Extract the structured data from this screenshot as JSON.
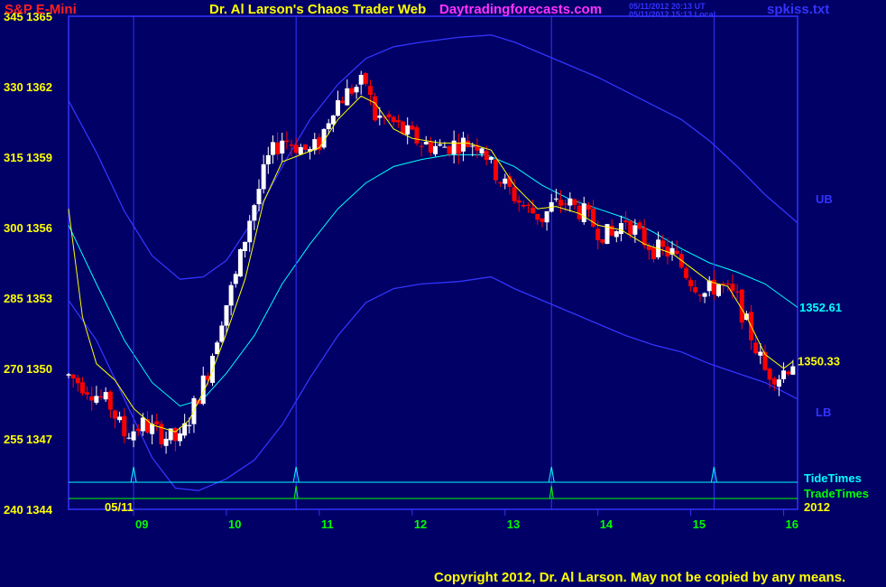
{
  "header": {
    "instrument": "S&P E-Mini",
    "title": "Dr. Al Larson's Chaos Trader Web",
    "site": "Daytradingforecasts.com",
    "timestamp_1": "05/11/2012 20:13 UT",
    "timestamp_2": "05/11/2012 15:13 Local",
    "file": "spkiss.txt"
  },
  "footer": {
    "copyright": "Copyright 2012, Dr. Al Larson. May not be copied by any means."
  },
  "colors": {
    "background": "#000066",
    "frame": "#3333ff",
    "up_candle": "#ffffff",
    "down_candle": "#ff0000",
    "ma_fast": "#ffff00",
    "ma_mid": "#00ffff",
    "bands": "#3333ff",
    "tide_times": "#00ffff",
    "trade_times": "#00ff00",
    "date_labels": "#00ff00",
    "price_labels": "#ffff00"
  },
  "chart_data": {
    "type": "candlestick",
    "y_left_labels": [
      "345",
      "330",
      "315",
      "300",
      "285",
      "270",
      "255",
      "240"
    ],
    "y_right_prices": [
      "1365",
      "1362",
      "1359",
      "1356",
      "1353",
      "1350",
      "1347",
      "1344"
    ],
    "ylim": [
      1344,
      1365
    ],
    "x_date_label": "05/11",
    "x_tick_labels": [
      "09",
      "10",
      "11",
      "12",
      "13",
      "14",
      "15",
      "16"
    ],
    "x_tick_hours": [
      9,
      10,
      11,
      12,
      13,
      14,
      15,
      16
    ],
    "x_range_hours": [
      8.3,
      16.15
    ],
    "year_label": "2012",
    "band_labels": {
      "upper": "UB",
      "lower": "LB"
    },
    "price_tags": [
      {
        "label": "1352.61",
        "value": 1352.61,
        "color": "#00ffff"
      },
      {
        "label": "1350.33",
        "value": 1350.33,
        "color": "#ffff00"
      }
    ],
    "event_lines": {
      "tide_times_label": "TideTimes",
      "trade_times_label": "TradeTimes",
      "tide_times_hours": [
        9.0,
        10.75,
        13.5,
        15.25
      ],
      "trade_times_hours": [
        10.75,
        13.5
      ]
    },
    "price_path": [
      [
        8.3,
        1349.7
      ],
      [
        8.5,
        1349.2
      ],
      [
        8.75,
        1348.4
      ],
      [
        8.9,
        1347.2
      ],
      [
        9.1,
        1347.6
      ],
      [
        9.35,
        1347.1
      ],
      [
        9.5,
        1346.9
      ],
      [
        9.65,
        1348.4
      ],
      [
        9.8,
        1349.9
      ],
      [
        9.95,
        1352.2
      ],
      [
        10.1,
        1353.9
      ],
      [
        10.25,
        1356.4
      ],
      [
        10.45,
        1358.9
      ],
      [
        10.6,
        1359.8
      ],
      [
        10.75,
        1359.5
      ],
      [
        10.9,
        1359.2
      ],
      [
        11.0,
        1359.6
      ],
      [
        11.15,
        1361.2
      ],
      [
        11.35,
        1361.9
      ],
      [
        11.5,
        1362.2
      ],
      [
        11.6,
        1360.7
      ],
      [
        11.75,
        1360.6
      ],
      [
        11.9,
        1360.1
      ],
      [
        12.1,
        1359.6
      ],
      [
        12.3,
        1359.4
      ],
      [
        12.5,
        1359.6
      ],
      [
        12.75,
        1359.6
      ],
      [
        12.85,
        1358.6
      ],
      [
        13.0,
        1357.8
      ],
      [
        13.2,
        1356.9
      ],
      [
        13.4,
        1356.4
      ],
      [
        13.5,
        1356.9
      ],
      [
        13.65,
        1357.1
      ],
      [
        13.85,
        1356.6
      ],
      [
        14.0,
        1355.9
      ],
      [
        14.15,
        1355.6
      ],
      [
        14.3,
        1356.4
      ],
      [
        14.45,
        1355.6
      ],
      [
        14.6,
        1355.1
      ],
      [
        14.8,
        1354.9
      ],
      [
        15.0,
        1353.8
      ],
      [
        15.15,
        1353.2
      ],
      [
        15.3,
        1353.6
      ],
      [
        15.5,
        1352.9
      ],
      [
        15.65,
        1351.4
      ],
      [
        15.8,
        1349.9
      ],
      [
        15.95,
        1349.7
      ],
      [
        16.1,
        1350.3
      ]
    ],
    "ma_fast": [
      [
        8.3,
        1356.8
      ],
      [
        8.45,
        1352.2
      ],
      [
        8.6,
        1350.2
      ],
      [
        8.8,
        1349.5
      ],
      [
        9.0,
        1348.3
      ],
      [
        9.2,
        1347.6
      ],
      [
        9.45,
        1347.3
      ],
      [
        9.6,
        1347.8
      ],
      [
        9.8,
        1349.4
      ],
      [
        10.0,
        1351.5
      ],
      [
        10.2,
        1353.8
      ],
      [
        10.4,
        1357.1
      ],
      [
        10.6,
        1358.8
      ],
      [
        10.8,
        1359.1
      ],
      [
        11.0,
        1359.4
      ],
      [
        11.2,
        1360.6
      ],
      [
        11.45,
        1361.6
      ],
      [
        11.6,
        1361.3
      ],
      [
        11.8,
        1360.2
      ],
      [
        12.0,
        1359.8
      ],
      [
        12.3,
        1359.6
      ],
      [
        12.6,
        1359.6
      ],
      [
        12.85,
        1359.3
      ],
      [
        13.1,
        1357.8
      ],
      [
        13.35,
        1356.8
      ],
      [
        13.55,
        1356.9
      ],
      [
        13.8,
        1356.6
      ],
      [
        14.0,
        1356.1
      ],
      [
        14.25,
        1355.9
      ],
      [
        14.5,
        1355.3
      ],
      [
        14.8,
        1354.9
      ],
      [
        15.0,
        1354.3
      ],
      [
        15.2,
        1353.7
      ],
      [
        15.4,
        1353.5
      ],
      [
        15.6,
        1352.2
      ],
      [
        15.8,
        1350.6
      ],
      [
        16.0,
        1350.0
      ],
      [
        16.1,
        1350.3
      ]
    ],
    "ma_mid": [
      [
        8.3,
        1356.1
      ],
      [
        8.6,
        1353.6
      ],
      [
        8.9,
        1351.2
      ],
      [
        9.2,
        1349.4
      ],
      [
        9.5,
        1348.4
      ],
      [
        9.75,
        1348.7
      ],
      [
        10.0,
        1349.8
      ],
      [
        10.3,
        1351.4
      ],
      [
        10.6,
        1353.6
      ],
      [
        10.9,
        1355.3
      ],
      [
        11.2,
        1356.8
      ],
      [
        11.5,
        1357.9
      ],
      [
        11.8,
        1358.6
      ],
      [
        12.1,
        1358.9
      ],
      [
        12.4,
        1359.1
      ],
      [
        12.8,
        1359.1
      ],
      [
        13.1,
        1358.6
      ],
      [
        13.4,
        1357.8
      ],
      [
        13.7,
        1357.2
      ],
      [
        14.0,
        1356.8
      ],
      [
        14.3,
        1356.4
      ],
      [
        14.6,
        1355.8
      ],
      [
        14.9,
        1355.1
      ],
      [
        15.2,
        1354.5
      ],
      [
        15.5,
        1354.1
      ],
      [
        15.8,
        1353.6
      ],
      [
        16.15,
        1352.6
      ]
    ],
    "band_upper": [
      [
        8.3,
        1361.4
      ],
      [
        8.6,
        1359.2
      ],
      [
        8.9,
        1356.7
      ],
      [
        9.2,
        1354.8
      ],
      [
        9.5,
        1353.8
      ],
      [
        9.75,
        1353.9
      ],
      [
        10.0,
        1354.6
      ],
      [
        10.3,
        1356.4
      ],
      [
        10.6,
        1358.6
      ],
      [
        10.9,
        1360.6
      ],
      [
        11.2,
        1362.1
      ],
      [
        11.5,
        1363.2
      ],
      [
        11.8,
        1363.7
      ],
      [
        12.1,
        1363.9
      ],
      [
        12.5,
        1364.1
      ],
      [
        12.85,
        1364.2
      ],
      [
        13.1,
        1363.9
      ],
      [
        13.4,
        1363.4
      ],
      [
        13.7,
        1362.9
      ],
      [
        14.0,
        1362.4
      ],
      [
        14.3,
        1361.8
      ],
      [
        14.6,
        1361.2
      ],
      [
        14.9,
        1360.6
      ],
      [
        15.2,
        1359.7
      ],
      [
        15.5,
        1358.6
      ],
      [
        15.8,
        1357.4
      ],
      [
        16.15,
        1356.2
      ]
    ],
    "band_lower": [
      [
        8.3,
        1352.9
      ],
      [
        8.6,
        1351.2
      ],
      [
        8.9,
        1348.7
      ],
      [
        9.2,
        1346.2
      ],
      [
        9.45,
        1344.9
      ],
      [
        9.7,
        1344.8
      ],
      [
        10.0,
        1345.3
      ],
      [
        10.3,
        1346.1
      ],
      [
        10.6,
        1347.6
      ],
      [
        10.9,
        1349.6
      ],
      [
        11.2,
        1351.4
      ],
      [
        11.5,
        1352.8
      ],
      [
        11.8,
        1353.4
      ],
      [
        12.1,
        1353.6
      ],
      [
        12.5,
        1353.7
      ],
      [
        12.85,
        1353.9
      ],
      [
        13.1,
        1353.4
      ],
      [
        13.4,
        1352.9
      ],
      [
        13.7,
        1352.4
      ],
      [
        14.0,
        1351.9
      ],
      [
        14.3,
        1351.4
      ],
      [
        14.6,
        1351.0
      ],
      [
        14.9,
        1350.7
      ],
      [
        15.2,
        1350.2
      ],
      [
        15.5,
        1349.8
      ],
      [
        15.8,
        1349.4
      ],
      [
        16.15,
        1348.7
      ]
    ]
  }
}
